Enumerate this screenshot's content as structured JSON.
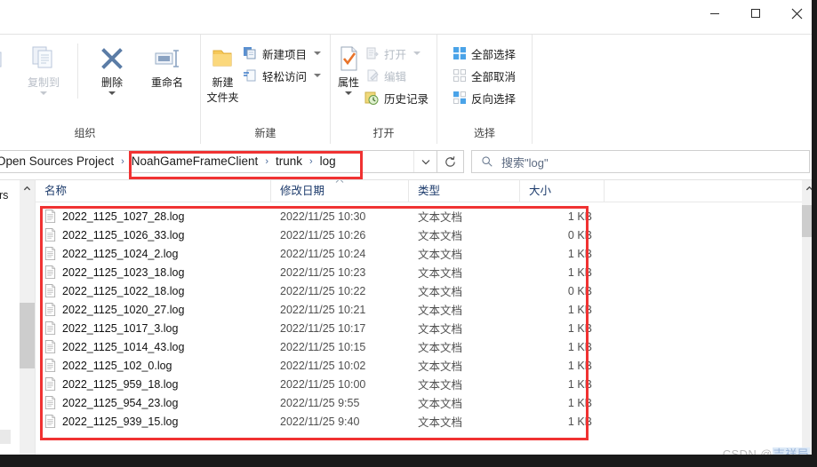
{
  "window": {
    "controls": [
      {
        "name": "minimize",
        "glyph": "minimize-icon"
      },
      {
        "name": "maximize",
        "glyph": "maximize-icon"
      },
      {
        "name": "close",
        "glyph": "close-icon"
      }
    ],
    "ribbon_collapse_icon": "chevron-up-icon",
    "help_label": "?"
  },
  "ribbon": {
    "groups": [
      {
        "label": "组织",
        "items": [
          {
            "label": "复制到",
            "icon": "copy-to-icon",
            "type": "big",
            "disabled": true,
            "caret": true
          },
          {
            "label": "删除",
            "icon": "delete-x-icon",
            "type": "big",
            "disabled": false,
            "caret": true
          },
          {
            "label": "重命名",
            "icon": "rename-icon",
            "type": "big",
            "disabled": false,
            "caret": false
          }
        ]
      },
      {
        "label": "新建",
        "items": [
          {
            "label": "新建\n文件夹",
            "label_line1": "新建",
            "label_line2": "文件夹",
            "icon": "new-folder-icon",
            "type": "big",
            "disabled": false,
            "caret": false
          },
          {
            "label": "新建项目",
            "icon": "new-item-icon",
            "type": "small",
            "disabled": false,
            "caret": true
          },
          {
            "label": "轻松访问",
            "icon": "easy-access-icon",
            "type": "small",
            "disabled": false,
            "caret": true
          }
        ]
      },
      {
        "label": "打开",
        "items": [
          {
            "label": "属性",
            "icon": "properties-icon",
            "type": "big",
            "disabled": false,
            "caret": true
          },
          {
            "label": "打开",
            "icon": "open-icon",
            "type": "small",
            "disabled": true,
            "caret": true
          },
          {
            "label": "编辑",
            "icon": "edit-icon",
            "type": "small",
            "disabled": true,
            "caret": false
          },
          {
            "label": "历史记录",
            "icon": "history-icon",
            "type": "small",
            "disabled": false,
            "caret": false
          }
        ]
      },
      {
        "label": "选择",
        "items": [
          {
            "label": "全部选择",
            "icon": "select-all-icon",
            "type": "small",
            "disabled": false,
            "caret": false
          },
          {
            "label": "全部取消",
            "icon": "select-none-icon",
            "type": "small",
            "disabled": false,
            "caret": false
          },
          {
            "label": "反向选择",
            "icon": "invert-selection-icon",
            "type": "small",
            "disabled": false,
            "caret": false
          }
        ]
      }
    ]
  },
  "address_bar": {
    "crumb_outside": "Open Sources Project",
    "crumbs": [
      "NoahGameFrameClient",
      "trunk",
      "log"
    ],
    "separator": "›",
    "dropdown_icon": "chevron-down-icon",
    "refresh_icon": "refresh-icon"
  },
  "search": {
    "icon": "search-icon",
    "value": "搜索\"log\""
  },
  "nav_pane": {
    "visible_text": "ers",
    "scroll_up_icon": "chevron-up-icon",
    "scroll_down_icon": "chevron-down-icon"
  },
  "file_list": {
    "columns": [
      "名称",
      "修改日期",
      "类型",
      "大小"
    ],
    "sorted_column_index": 1,
    "sort_icon": "chevron-up-small-icon",
    "rows": [
      {
        "name": "2022_1125_1027_28.log",
        "date": "2022/11/25 10:30",
        "type": "文本文档",
        "size": "1 KB"
      },
      {
        "name": "2022_1125_1026_33.log",
        "date": "2022/11/25 10:26",
        "type": "文本文档",
        "size": "0 KB"
      },
      {
        "name": "2022_1125_1024_2.log",
        "date": "2022/11/25 10:24",
        "type": "文本文档",
        "size": "1 KB"
      },
      {
        "name": "2022_1125_1023_18.log",
        "date": "2022/11/25 10:23",
        "type": "文本文档",
        "size": "1 KB"
      },
      {
        "name": "2022_1125_1022_18.log",
        "date": "2022/11/25 10:22",
        "type": "文本文档",
        "size": "0 KB"
      },
      {
        "name": "2022_1125_1020_27.log",
        "date": "2022/11/25 10:21",
        "type": "文本文档",
        "size": "1 KB"
      },
      {
        "name": "2022_1125_1017_3.log",
        "date": "2022/11/25 10:17",
        "type": "文本文档",
        "size": "1 KB"
      },
      {
        "name": "2022_1125_1014_43.log",
        "date": "2022/11/25 10:15",
        "type": "文本文档",
        "size": "1 KB"
      },
      {
        "name": "2022_1125_102_0.log",
        "date": "2022/11/25 10:02",
        "type": "文本文档",
        "size": "1 KB"
      },
      {
        "name": "2022_1125_959_18.log",
        "date": "2022/11/25 10:00",
        "type": "文本文档",
        "size": "1 KB"
      },
      {
        "name": "2022_1125_954_23.log",
        "date": "2022/11/25 9:55",
        "type": "文本文档",
        "size": "1 KB"
      },
      {
        "name": "2022_1125_939_15.log",
        "date": "2022/11/25 9:40",
        "type": "文本文档",
        "size": "1 KB"
      }
    ],
    "row_icon": "text-document-icon"
  },
  "annotations": {
    "highlight_color": "#f03232",
    "boxes": [
      "breadcrumb-path",
      "file-list-rows"
    ]
  },
  "watermark": {
    "prefix": "CSDN @",
    "name": "吉祥局"
  },
  "colors": {
    "accent": "#1a7fd4",
    "highlight": "#f03232",
    "header_text": "#1b3a6b",
    "folder_yellow": "#f6c859"
  }
}
